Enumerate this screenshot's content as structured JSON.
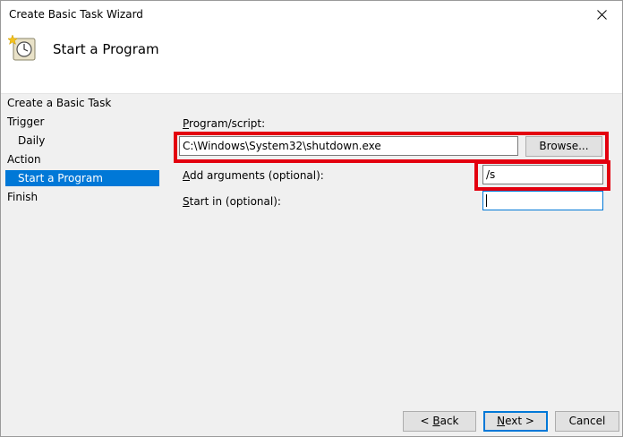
{
  "window": {
    "title": "Create Basic Task Wizard"
  },
  "header": {
    "title": "Start a Program"
  },
  "nav": {
    "items": [
      {
        "label": "Create a Basic Task"
      },
      {
        "label": "Trigger"
      },
      {
        "label": "Daily"
      },
      {
        "label": "Action"
      },
      {
        "label": "Start a Program"
      },
      {
        "label": "Finish"
      }
    ]
  },
  "form": {
    "program_label_mnemonic": "P",
    "program_label_rest": "rogram/script:",
    "program_value": "C:\\Windows\\System32\\shutdown.exe",
    "browse_label": "Browse...",
    "args_label_mnemonic": "A",
    "args_label_rest": "dd arguments (optional):",
    "args_value": "/s",
    "startin_label_mnemonic": "S",
    "startin_label_rest": "tart in (optional):",
    "startin_value": ""
  },
  "footer": {
    "back_prefix": "< ",
    "back_mnemonic": "B",
    "back_rest": "ack",
    "next_mnemonic": "N",
    "next_rest": "ext >",
    "cancel_label": "Cancel"
  },
  "colors": {
    "selection": "#0078d7",
    "annotation": "#e3000f"
  }
}
